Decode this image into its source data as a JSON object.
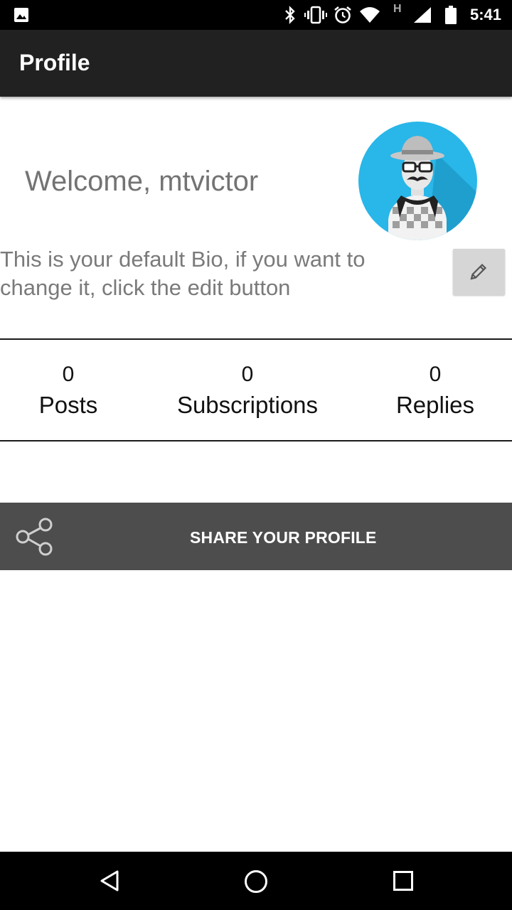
{
  "status_bar": {
    "time": "5:41",
    "icons": [
      "image-icon",
      "bluetooth-icon",
      "vibrate-icon",
      "alarm-icon",
      "wifi-icon",
      "h-network-icon",
      "signal-icon",
      "battery-icon"
    ],
    "network_letter": "H"
  },
  "app_bar": {
    "title": "Profile"
  },
  "profile": {
    "welcome": "Welcome, mtvictor",
    "bio": "This is your default Bio, if you want to change it, click the edit button",
    "avatar_color": "#29B6E8"
  },
  "stats": [
    {
      "value": "0",
      "label": "Posts"
    },
    {
      "value": "0",
      "label": "Subscriptions"
    },
    {
      "value": "0",
      "label": "Replies"
    }
  ],
  "share": {
    "label": "SHARE YOUR PROFILE"
  },
  "nav_bar": {
    "icons": [
      "back-icon",
      "home-icon",
      "recents-icon"
    ]
  }
}
